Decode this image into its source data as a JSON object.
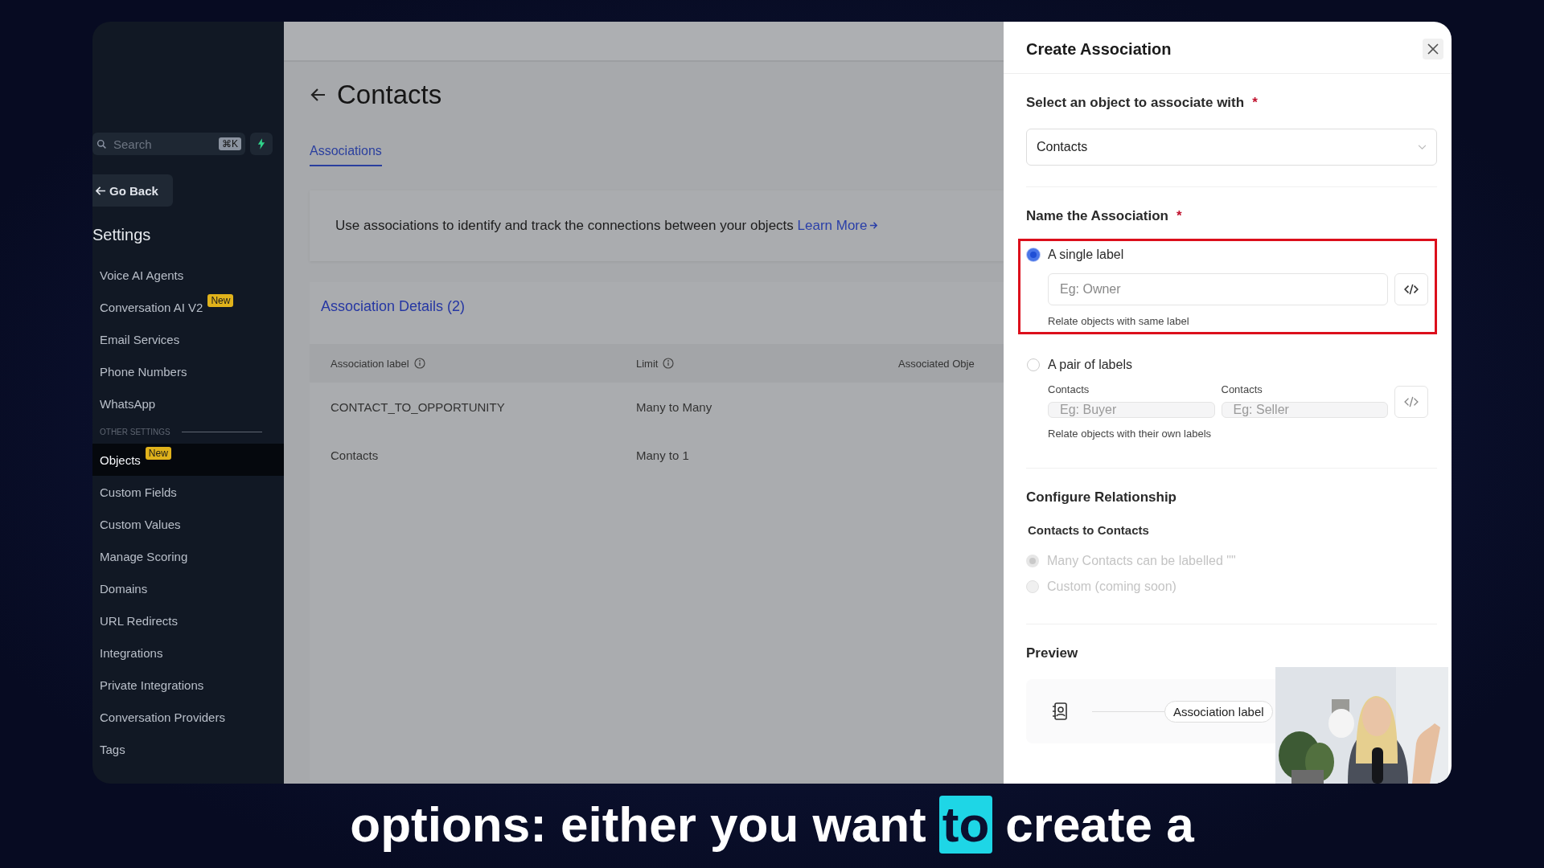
{
  "sidebar": {
    "search": {
      "placeholder": "Search",
      "shortcut": "⌘K"
    },
    "back": "Go Back",
    "title": "Settings",
    "items": [
      {
        "kind": "item",
        "label": "Voice AI Agents",
        "selected": false
      },
      {
        "kind": "item",
        "label": "Conversation AI V2",
        "badge": "New",
        "selected": false
      },
      {
        "kind": "item",
        "label": "Email Services",
        "selected": false
      },
      {
        "kind": "item",
        "label": "Phone Numbers",
        "selected": false
      },
      {
        "kind": "item",
        "label": "WhatsApp",
        "selected": false
      },
      {
        "kind": "section",
        "label": "OTHER SETTINGS"
      },
      {
        "kind": "item",
        "label": "Objects",
        "badge": "New",
        "selected": true
      },
      {
        "kind": "item",
        "label": "Custom Fields",
        "selected": false
      },
      {
        "kind": "item",
        "label": "Custom Values",
        "selected": false
      },
      {
        "kind": "item",
        "label": "Manage Scoring",
        "selected": false
      },
      {
        "kind": "item",
        "label": "Domains",
        "selected": false
      },
      {
        "kind": "item",
        "label": "URL Redirects",
        "selected": false
      },
      {
        "kind": "item",
        "label": "Integrations",
        "selected": false
      },
      {
        "kind": "item",
        "label": "Private Integrations",
        "selected": false
      },
      {
        "kind": "item",
        "label": "Conversation Providers",
        "selected": false
      },
      {
        "kind": "item",
        "label": "Tags",
        "selected": false
      }
    ]
  },
  "main": {
    "title": "Contacts",
    "tabs": [
      {
        "label": "Associations",
        "selected": true
      }
    ],
    "info": {
      "text": "Use associations to identify and track the connections between your objects",
      "link": "Learn More"
    },
    "details": {
      "title": "Association Details (2)",
      "columns": [
        {
          "label": "Association label",
          "info": true
        },
        {
          "label": "Limit",
          "info": true
        },
        {
          "label": "Associated Obje",
          "info": false
        }
      ],
      "rows": [
        [
          "CONTACT_TO_OPPORTUNITY",
          "Many to Many"
        ],
        [
          "Contacts",
          "Many to 1"
        ]
      ]
    }
  },
  "drawer": {
    "title": "Create Association",
    "required_mark": "*",
    "object_label": "Select an object to associate with",
    "object_value": "Contacts",
    "name_label": "Name the Association",
    "options": [
      {
        "kind": "single",
        "label": "A single label",
        "selected": true,
        "highlighted": true,
        "fields": [
          {
            "placeholder": "Eg: Owner"
          }
        ],
        "help": "Relate objects with same label"
      },
      {
        "kind": "pair",
        "label": "A pair of labels",
        "selected": false,
        "highlighted": false,
        "fields": [
          {
            "caption": "Contacts",
            "placeholder": "Eg: Buyer"
          },
          {
            "caption": "Contacts",
            "placeholder": "Eg: Seller"
          }
        ],
        "help": "Relate objects with their own labels"
      }
    ],
    "configure": {
      "title": "Configure Relationship",
      "subtitle": "Contacts to Contacts",
      "choices": [
        {
          "label": "Many Contacts can be labelled \"\"",
          "selected": true,
          "disabled": true
        },
        {
          "label": "Custom (coming soon)",
          "selected": false,
          "disabled": true
        }
      ]
    },
    "preview": {
      "title": "Preview",
      "chip": "Association label"
    }
  },
  "caption": [
    {
      "text": "options: either you want",
      "highlighted": false
    },
    {
      "text": "to",
      "highlighted": true
    },
    {
      "text": "create a",
      "highlighted": false
    }
  ]
}
